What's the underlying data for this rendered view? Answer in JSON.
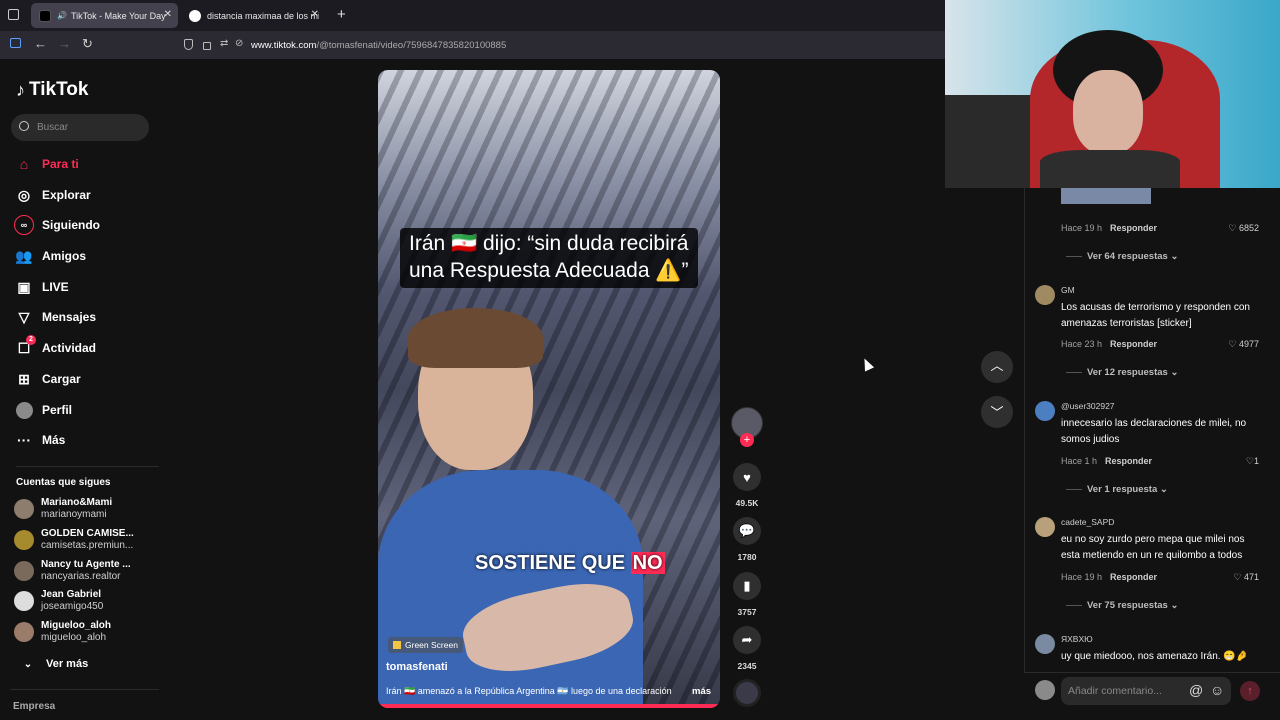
{
  "browser": {
    "tabs": [
      {
        "title": "TikTok - Make Your Day",
        "active": true
      },
      {
        "title": "distancia maximaa de los misil"
      }
    ],
    "new_tab": "+",
    "url_domain": "www.tiktok.com",
    "url_path": "/@tomasfenati/video/7596847835820100885"
  },
  "sidebar": {
    "logo": "TikTok",
    "search_placeholder": "Buscar",
    "nav": [
      {
        "label": "Para ti",
        "icon": "home-icon"
      },
      {
        "label": "Explorar",
        "icon": "compass-icon"
      },
      {
        "label": "Siguiendo",
        "icon": "following-icon"
      },
      {
        "label": "Amigos",
        "icon": "friends-icon"
      },
      {
        "label": "LIVE",
        "icon": "live-icon"
      },
      {
        "label": "Mensajes",
        "icon": "messages-icon"
      },
      {
        "label": "Actividad",
        "icon": "activity-icon",
        "badge": "2"
      },
      {
        "label": "Cargar",
        "icon": "upload-icon"
      },
      {
        "label": "Perfil",
        "icon": "profile-icon"
      },
      {
        "label": "Más",
        "icon": "more-icon"
      }
    ],
    "following_title": "Cuentas que sigues",
    "following": [
      {
        "name": "Mariano&Mami",
        "handle": "marianoymami"
      },
      {
        "name": "GOLDEN CAMISE...",
        "handle": "camisetas.premiun..."
      },
      {
        "name": "Nancy tu Agente ...",
        "handle": "nancyarias.realtor"
      },
      {
        "name": "Jean Gabriel",
        "handle": "joseamigo450"
      },
      {
        "name": "Migueloo_aloh",
        "handle": "migueloo_aloh"
      }
    ],
    "see_more": "Ver más",
    "company": "Empresa"
  },
  "video": {
    "caption_line1": "Irán 🇮🇷 dijo: “sin duda recibirá",
    "caption_line2": "una Respuesta Adecuada ⚠️”",
    "subtitle_a": "SOSTIENE QUE ",
    "subtitle_b": "NO",
    "effect": "Green Screen",
    "author": "tomasfenati",
    "description": "Irán 🇮🇷 amenazó a la República Argentina 🇦🇷 luego de una declaración",
    "more": "más",
    "likes": "49.5K",
    "comments": "1780",
    "saves": "3757",
    "shares": "2345"
  },
  "comments": [
    {
      "username": "",
      "text": "",
      "time": "Hace 19 h",
      "reply": "Responder",
      "likes": "6852",
      "replies": "Ver 64 respuestas"
    },
    {
      "username": "GM",
      "text": "Los acusas de terrorismo y responden con amenazas terroristas [sticker]",
      "time": "Hace 23 h",
      "reply": "Responder",
      "likes": "4977",
      "replies": "Ver 12 respuestas"
    },
    {
      "username": "@user302927",
      "text": "innecesario las declaraciones de milei, no somos judios",
      "time": "Hace 1 h",
      "reply": "Responder",
      "likes": "1",
      "replies": "Ver 1 respuesta"
    },
    {
      "username": "cadete_SAPD",
      "text": "eu no soy zurdo pero mepa que milei nos esta metiendo en un re quilombo a todos",
      "time": "Hace 19 h",
      "reply": "Responder",
      "likes": "471",
      "replies": "Ver 75 respuestas"
    },
    {
      "username": "ЯΧВΧЮ",
      "text": "uy que miedooo, nos amenazo Irán. 😁🤌"
    }
  ],
  "comment_input_placeholder": "Añadir comentario...",
  "colors": {
    "accent": "#fe2c55",
    "background": "#121212"
  }
}
